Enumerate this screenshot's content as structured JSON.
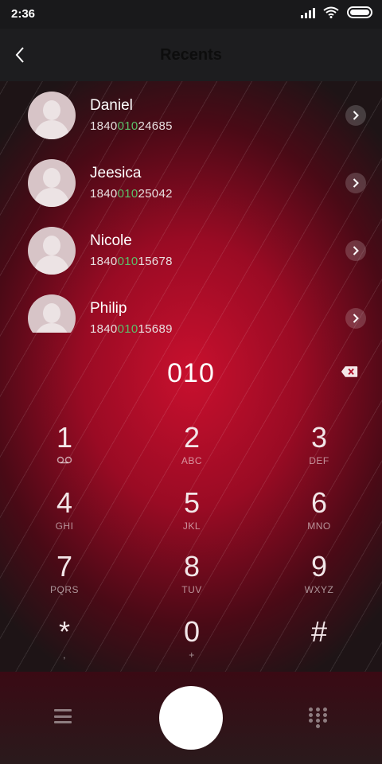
{
  "status": {
    "time": "2:36"
  },
  "header": {
    "title": "Recents"
  },
  "contacts": [
    {
      "name": "Daniel",
      "number_prefix": "1840",
      "number_match": "010",
      "number_suffix": "24685"
    },
    {
      "name": "Jeesica",
      "number_prefix": "1840",
      "number_match": "010",
      "number_suffix": "25042"
    },
    {
      "name": "Nicole",
      "number_prefix": "1840",
      "number_match": "010",
      "number_suffix": "15678"
    },
    {
      "name": "Philip",
      "number_prefix": "1840",
      "number_match": "010",
      "number_suffix": "15689"
    }
  ],
  "dial": {
    "entered": "010"
  },
  "keypad": [
    {
      "digit": "1",
      "letters": ""
    },
    {
      "digit": "2",
      "letters": "ABC"
    },
    {
      "digit": "3",
      "letters": "DEF"
    },
    {
      "digit": "4",
      "letters": "GHI"
    },
    {
      "digit": "5",
      "letters": "JKL"
    },
    {
      "digit": "6",
      "letters": "MNO"
    },
    {
      "digit": "7",
      "letters": "PQRS"
    },
    {
      "digit": "8",
      "letters": "TUV"
    },
    {
      "digit": "9",
      "letters": "WXYZ"
    },
    {
      "digit": "*",
      "letters": ","
    },
    {
      "digit": "0",
      "letters": "+"
    },
    {
      "digit": "#",
      "letters": ""
    }
  ],
  "colors": {
    "accent_red": "#c8102e",
    "match_green": "#5bbf6a",
    "header_bg": "#1d1d1f"
  },
  "icons": {
    "back": "chevron-left-icon",
    "backspace": "backspace-icon",
    "voicemail": "voicemail-icon",
    "menu": "menu-icon",
    "dialpad": "dialpad-icon"
  }
}
